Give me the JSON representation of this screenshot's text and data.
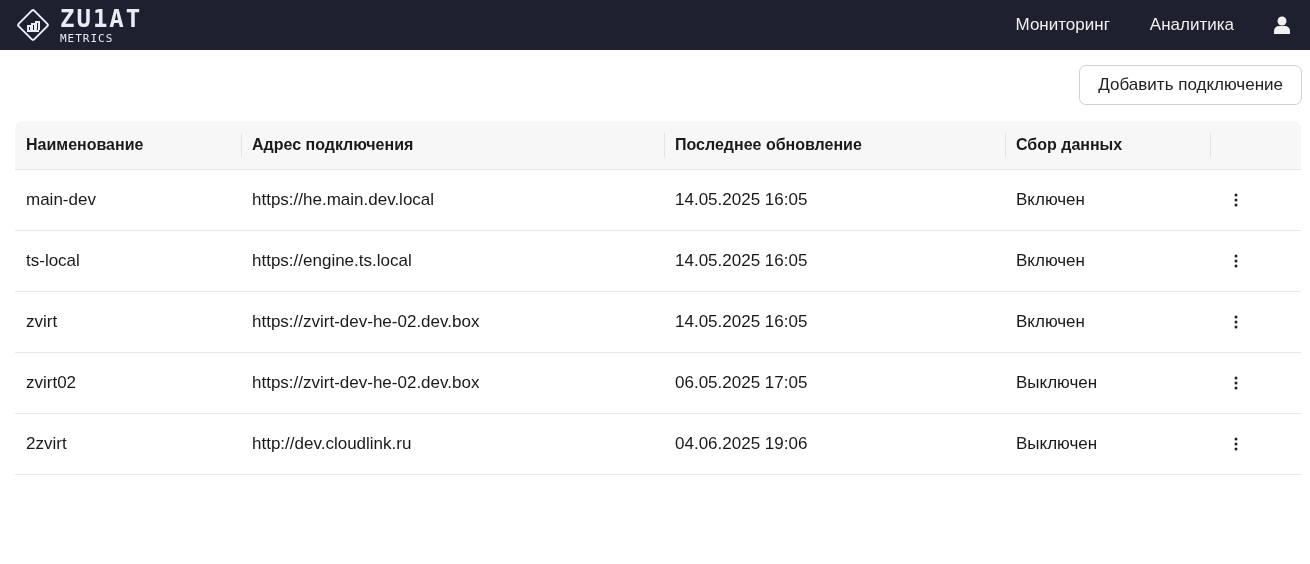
{
  "header": {
    "logo": {
      "title": "ZU1AT",
      "subtitle": "METRICS"
    },
    "nav": [
      {
        "label": "Мониторинг"
      },
      {
        "label": "Аналитика"
      }
    ]
  },
  "toolbar": {
    "add_button": "Добавить подключение"
  },
  "table": {
    "columns": [
      "Наименование",
      "Адрес подключения",
      "Последнее обновление",
      "Сбор данных"
    ],
    "rows": [
      {
        "cells": [
          "main-dev",
          "https://he.main.dev.local",
          "14.05.2025 16:05",
          "Включен"
        ]
      },
      {
        "cells": [
          "ts-local",
          "https://engine.ts.local",
          "14.05.2025 16:05",
          "Включен"
        ]
      },
      {
        "cells": [
          "zvirt",
          "https://zvirt-dev-he-02.dev.box",
          "14.05.2025 16:05",
          "Включен"
        ]
      },
      {
        "cells": [
          "zvirt02",
          "https://zvirt-dev-he-02.dev.box",
          "06.05.2025 17:05",
          "Выключен"
        ]
      },
      {
        "cells": [
          "2zvirt",
          "http://dev.cloudlink.ru",
          "04.06.2025 19:06",
          "Выключен"
        ]
      }
    ]
  }
}
